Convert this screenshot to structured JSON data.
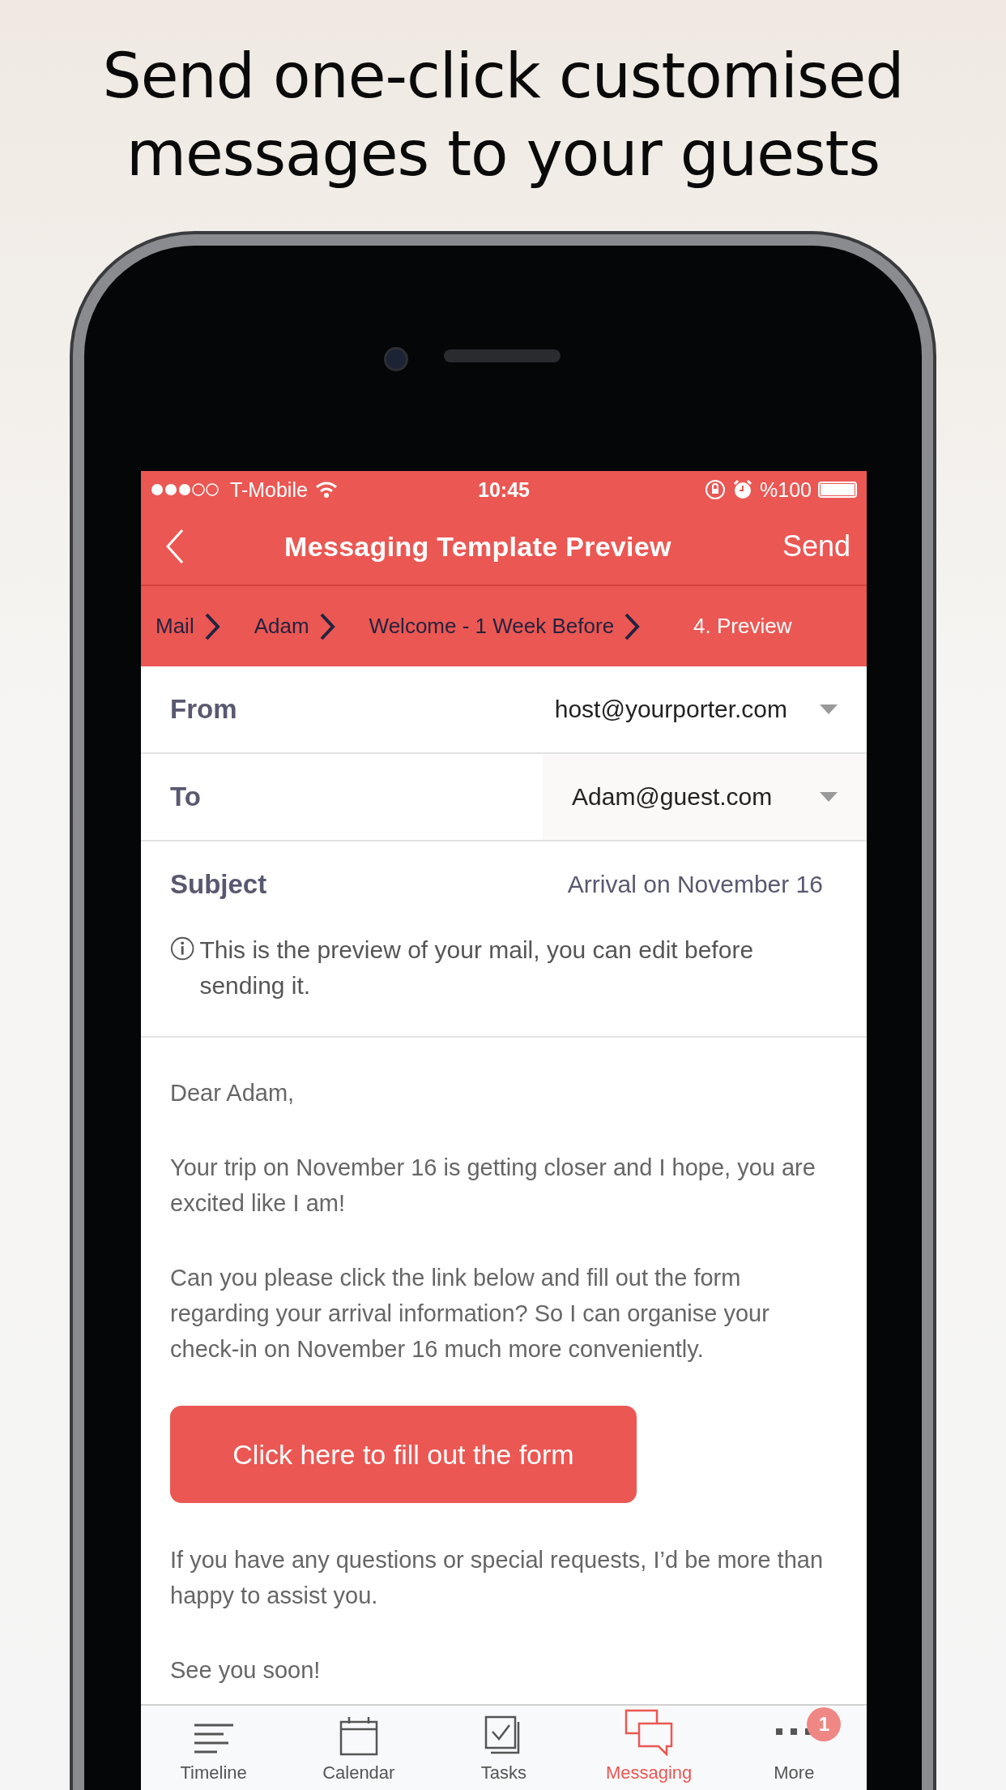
{
  "headline": "Send one-click customised messages to your guests",
  "status_bar": {
    "carrier": "T-Mobile",
    "time": "10:45",
    "battery_text": "%100",
    "level": 1
  },
  "nav": {
    "title": "Messaging Template Preview",
    "action": "Send"
  },
  "breadcrumb": [
    {
      "label": "Mail",
      "selected": false
    },
    {
      "label": "Adam",
      "selected": false
    },
    {
      "label": "Welcome - 1 Week Before",
      "selected": false
    },
    {
      "label": "4. Preview",
      "selected": true
    }
  ],
  "fields": [
    {
      "kind": "dropdown",
      "label": "From",
      "value": "host@yourporter.com"
    },
    {
      "kind": "dropdown",
      "label": "To",
      "value": "Adam@guest.com"
    },
    {
      "kind": "text",
      "label": "Subject",
      "value": "Arrival on November 16"
    }
  ],
  "info": "This is the preview of your mail, you can edit before sending it.",
  "body": [
    {
      "kind": "paragraph",
      "text": "Dear Adam,"
    },
    {
      "kind": "paragraph",
      "text": "Your trip on November 16 is getting closer and I hope, you are excited like I am!"
    },
    {
      "kind": "paragraph",
      "text": "Can you please click the link below and fill out the form regarding your arrival information? So I can organise your check-in on November 16 much more conveniently."
    },
    {
      "kind": "button",
      "text": "Click here to fill out the form"
    },
    {
      "kind": "paragraph",
      "text": "If you have any questions or special requests, I’d be more than happy to assist you."
    },
    {
      "kind": "paragraph",
      "text": "See you soon!"
    }
  ],
  "tabs": [
    {
      "kind": "timeline",
      "label": "Timeline",
      "selected": false
    },
    {
      "kind": "calendar",
      "label": "Calendar",
      "selected": false
    },
    {
      "kind": "tasks",
      "label": "Tasks",
      "selected": false
    },
    {
      "kind": "messaging",
      "label": "Messaging",
      "selected": true
    },
    {
      "kind": "more",
      "label": "More",
      "selected": false,
      "badge": "1"
    }
  ]
}
